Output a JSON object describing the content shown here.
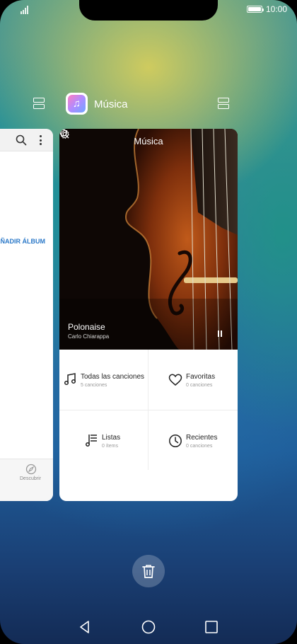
{
  "status_bar": {
    "time": "10:00",
    "battery_level": 1.0,
    "signal_bars": 4
  },
  "recents": {
    "current_app": {
      "title": "Música",
      "icon": "music-note-icon"
    }
  },
  "left_card": {
    "add_album_label": "AÑADIR ÁLBUM",
    "bottom_tab_label": "Descubrir"
  },
  "music_card": {
    "header_title": "Música",
    "now_playing": {
      "title": "Polonaise",
      "artist": "Carlo Chiarappa"
    },
    "categories": [
      {
        "label": "Todas las canciones",
        "count": "5 canciones",
        "icon": "music-note-icon"
      },
      {
        "label": "Favoritas",
        "count": "0 canciones",
        "icon": "heart-icon"
      },
      {
        "label": "Listas",
        "count": "0 ítems",
        "icon": "playlist-icon"
      },
      {
        "label": "Recientes",
        "count": "0 canciones",
        "icon": "clock-icon"
      }
    ]
  },
  "colors": {
    "accent": "#2a78c8",
    "artwork_bg": "#0f0806",
    "violin": "#8a3b12"
  }
}
